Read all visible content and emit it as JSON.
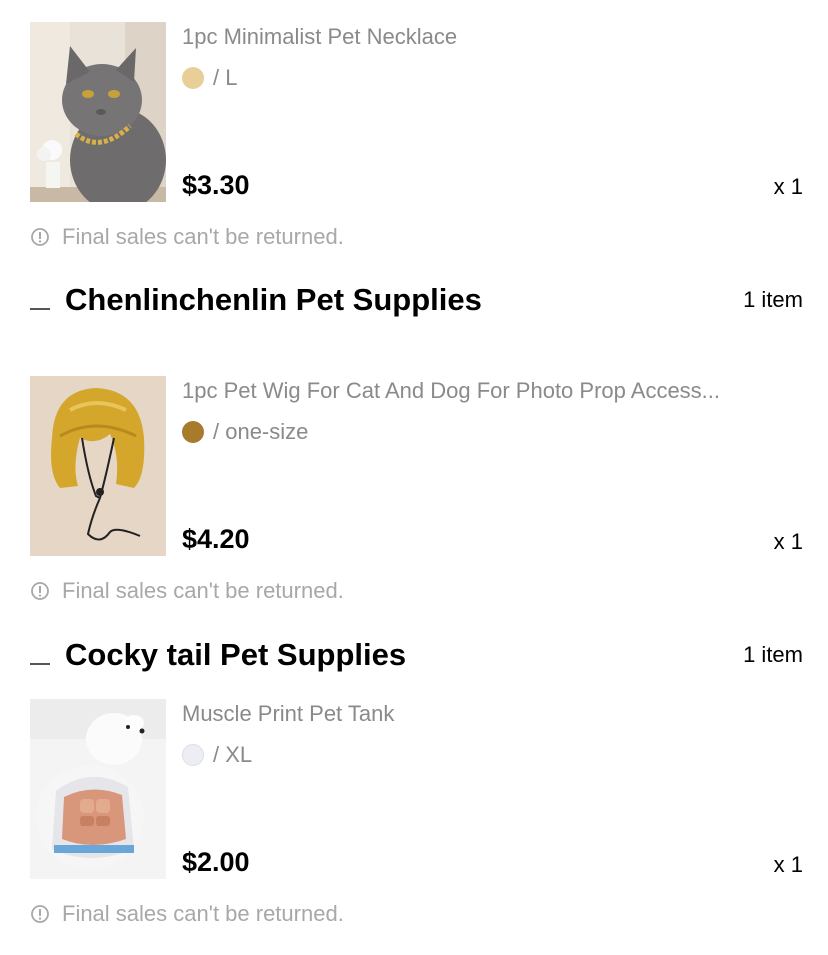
{
  "items": [
    {
      "title": "1pc Minimalist Pet Necklace",
      "swatch_color": "#e8cf98",
      "variant_text": "/ L",
      "price": "$3.30",
      "qty": "x 1",
      "note": "Final sales can't be returned."
    },
    {
      "title": "1pc Pet Wig For Cat And Dog For Photo Prop Access...",
      "swatch_color": "#a87a2c",
      "variant_text": "/ one-size",
      "price": "$4.20",
      "qty": "x 1",
      "note": "Final sales can't be returned."
    },
    {
      "title": "Muscle Print Pet Tank",
      "swatch_color": "#eceef3",
      "variant_text": "/ XL",
      "price": "$2.00",
      "qty": "x 1",
      "note": "Final sales can't be returned."
    }
  ],
  "stores": [
    {
      "name": "Chenlinchenlin Pet Supplies",
      "count": "1 item"
    },
    {
      "name": "Cocky tail Pet Supplies",
      "count": "1 item"
    }
  ]
}
